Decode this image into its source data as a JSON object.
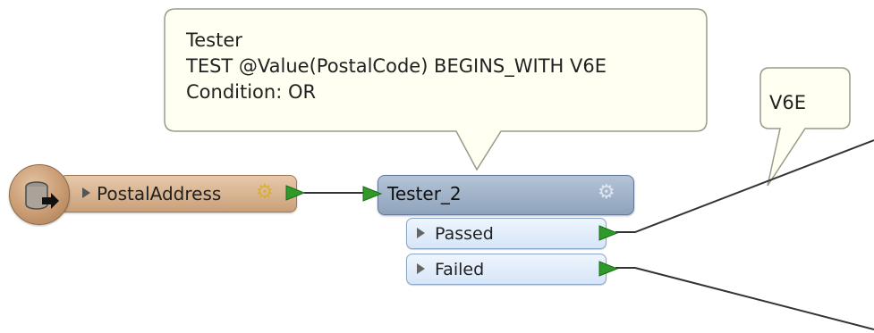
{
  "canvas": {
    "background": "#ffffff"
  },
  "annotations": {
    "tester_callout": {
      "lines": [
        "Tester",
        "TEST @Value(PostalCode) BEGINS_WITH V6E",
        "Condition: OR"
      ]
    },
    "connection_callout": {
      "label": "V6E"
    }
  },
  "nodes": {
    "reader": {
      "name": "PostalAddress",
      "icon": "database-reader-icon",
      "color": "#c99b72"
    },
    "tester": {
      "name": "Tester_2",
      "icon": "gear-icon",
      "color": "#8ea3bc",
      "ports": [
        {
          "label": "Passed"
        },
        {
          "label": "Failed"
        }
      ]
    }
  },
  "colors": {
    "port_fill": "#d6e6f8",
    "arrow_green": "#2f9a2a",
    "connector": "#333333",
    "callout_fill": "#fffff2",
    "callout_border": "#9a9a8a"
  }
}
